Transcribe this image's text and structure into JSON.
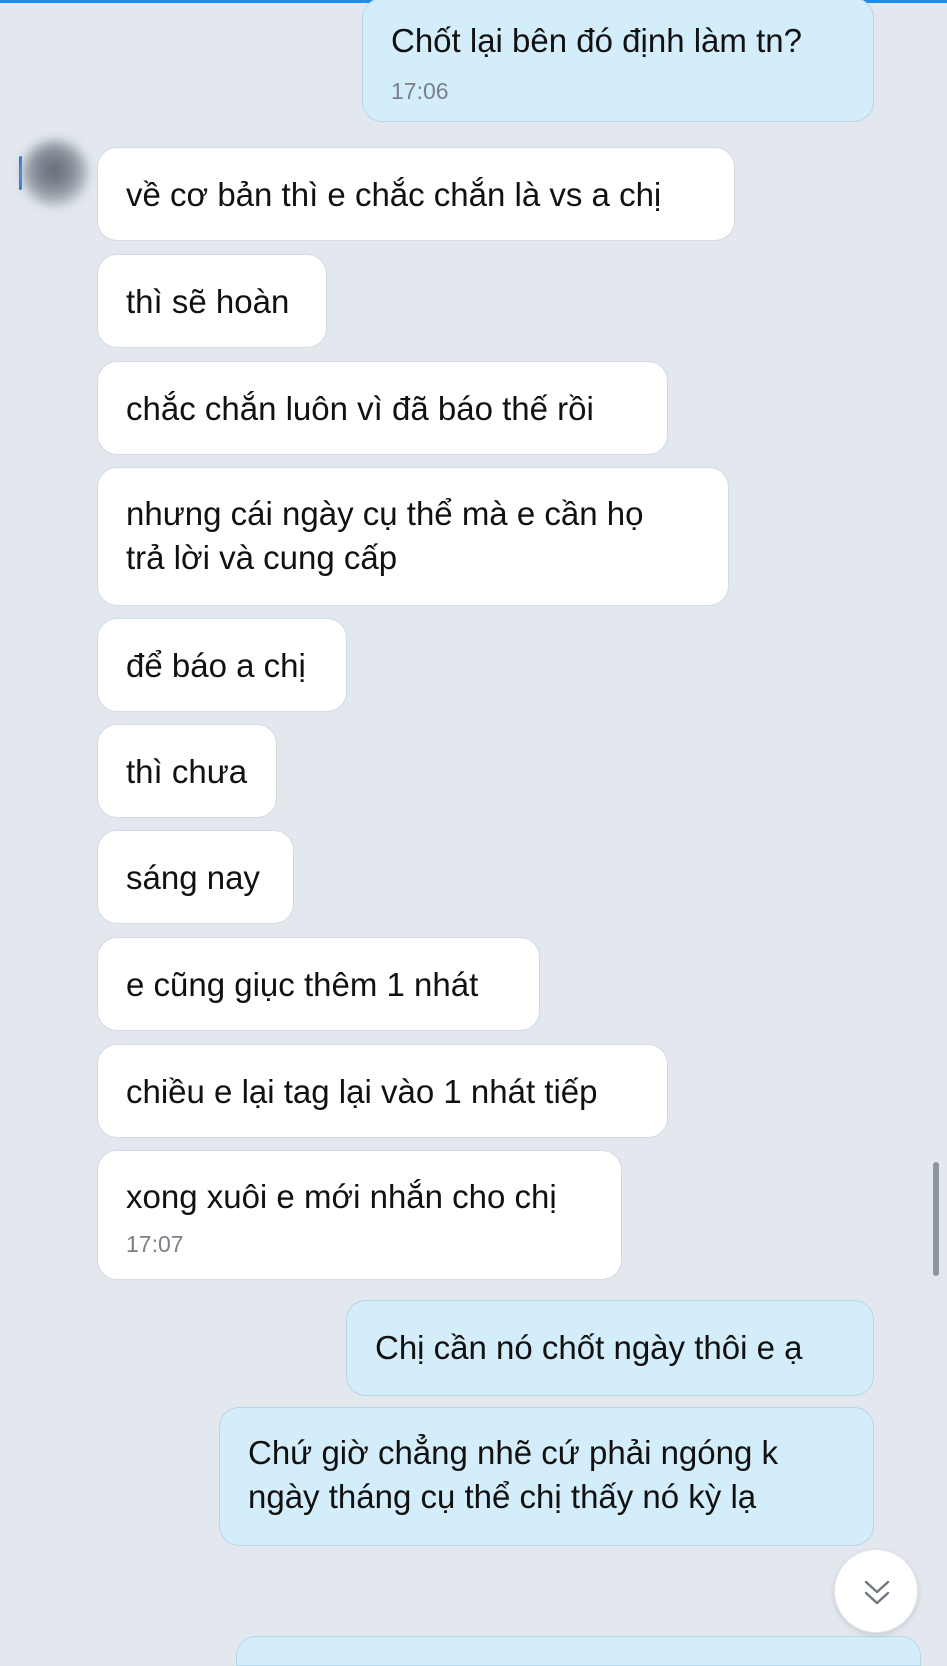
{
  "messages": [
    {
      "direction": "out",
      "text": "Chốt lại bên đó định làm tn?",
      "time": "17:06"
    },
    {
      "direction": "in",
      "text": "về cơ bản thì e chắc chắn là vs a chị"
    },
    {
      "direction": "in",
      "text": "thì sẽ hoàn"
    },
    {
      "direction": "in",
      "text": "chắc chắn luôn vì đã báo thế rồi"
    },
    {
      "direction": "in",
      "lines": [
        "nhưng cái ngày cụ thể mà e cần họ",
        "trả lời và cung cấp"
      ]
    },
    {
      "direction": "in",
      "text": "để báo a chị"
    },
    {
      "direction": "in",
      "text": "thì chưa"
    },
    {
      "direction": "in",
      "text": "sáng nay"
    },
    {
      "direction": "in",
      "text": "e cũng giục thêm 1 nhát"
    },
    {
      "direction": "in",
      "text": "chiều e lại tag lại vào 1 nhát tiếp"
    },
    {
      "direction": "in",
      "text": "xong xuôi e mới nhắn cho chị",
      "time": "17:07"
    },
    {
      "direction": "out",
      "text": "Chị cần nó chốt ngày thôi e ạ"
    },
    {
      "direction": "out",
      "lines": [
        "Chứ giờ chẳng nhẽ cứ phải ngóng k",
        "ngày tháng cụ thể chị thấy nó kỳ lạ"
      ]
    }
  ],
  "controls": {
    "scroll_down_icon": "double-chevron-down-icon"
  },
  "colors": {
    "background": "#e3e8ef",
    "incoming_bubble": "#ffffff",
    "outgoing_bubble": "#d4edfb",
    "timestamp": "#7a8089",
    "accent": "#1d8cf0"
  }
}
